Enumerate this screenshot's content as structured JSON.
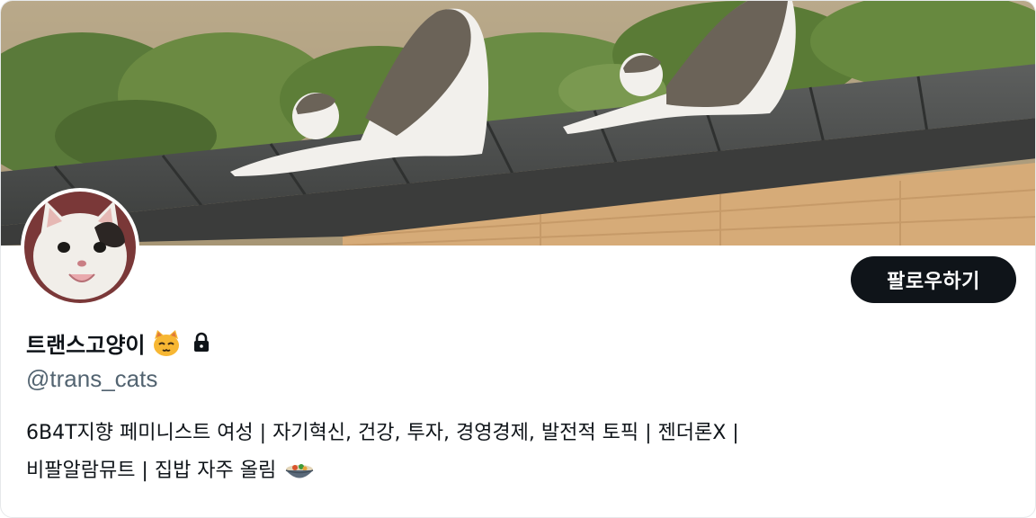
{
  "profile": {
    "display_name": "트랜스고양이",
    "handle": "@trans_cats",
    "name_emoji": "cat-face-icon",
    "protected_icon": "lock-icon",
    "bio_line1": "6B4T지향 페미니스트 여성 | 자기혁신, 건강, 투자, 경영경제, 발전적 토픽 | 젠더론X |",
    "bio_line2": "비팔알람뮤트 | 집밥 자주 올림",
    "bio_emoji": "bowl-icon"
  },
  "actions": {
    "follow_label": "팔로우하기"
  },
  "colors": {
    "button_bg": "#0f1419",
    "handle_gray": "#536471",
    "text": "#0f1419"
  }
}
